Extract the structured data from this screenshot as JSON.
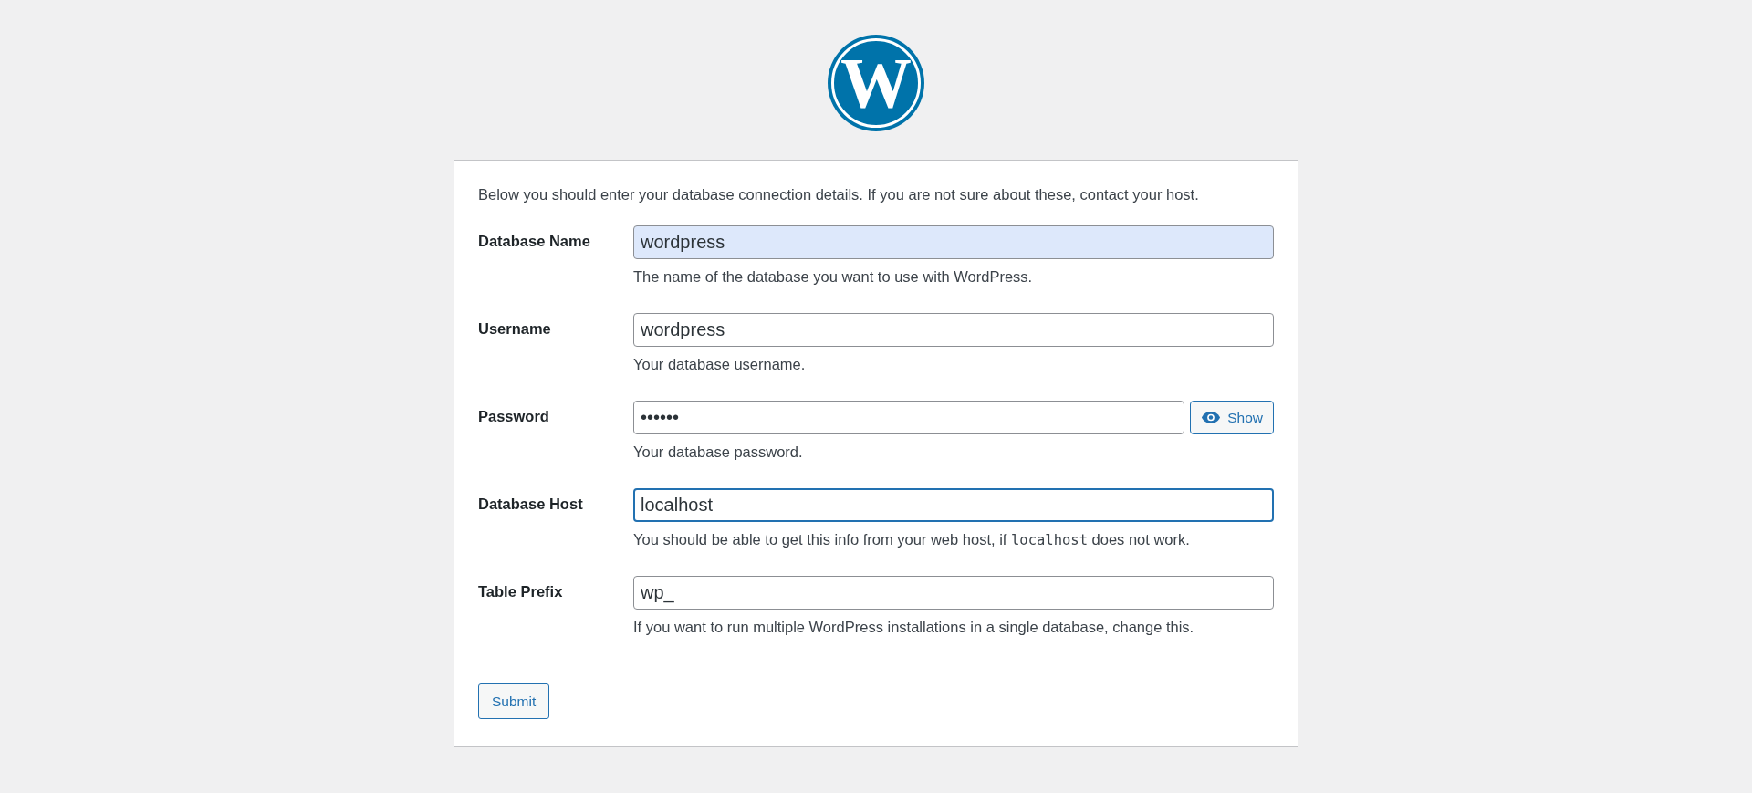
{
  "logo": {
    "letter": "W"
  },
  "intro": "Below you should enter your database connection details. If you are not sure about these, contact your host.",
  "fields": [
    {
      "label": "Database Name",
      "kind": "text",
      "value": "wordpress",
      "autofilled": true,
      "focused": false,
      "description": [
        {
          "kind": "text",
          "text": "The name of the database you want to use with WordPress."
        }
      ]
    },
    {
      "label": "Username",
      "kind": "text",
      "value": "wordpress",
      "autofilled": false,
      "focused": false,
      "description": [
        {
          "kind": "text",
          "text": "Your database username."
        }
      ]
    },
    {
      "label": "Password",
      "kind": "password",
      "value": "••••••",
      "autofilled": false,
      "focused": false,
      "toggle": "Show",
      "description": [
        {
          "kind": "text",
          "text": "Your database password."
        }
      ]
    },
    {
      "label": "Database Host",
      "kind": "text",
      "value": "localhost",
      "autofilled": false,
      "focused": true,
      "description": [
        {
          "kind": "text",
          "text": "You should be able to get this info from your web host, if "
        },
        {
          "kind": "code",
          "text": "localhost"
        },
        {
          "kind": "text",
          "text": " does not work."
        }
      ]
    },
    {
      "label": "Table Prefix",
      "kind": "text",
      "value": "wp_",
      "autofilled": false,
      "focused": false,
      "description": [
        {
          "kind": "text",
          "text": "If you want to run multiple WordPress installations in a single database, change this."
        }
      ]
    }
  ],
  "submit": "Submit"
}
